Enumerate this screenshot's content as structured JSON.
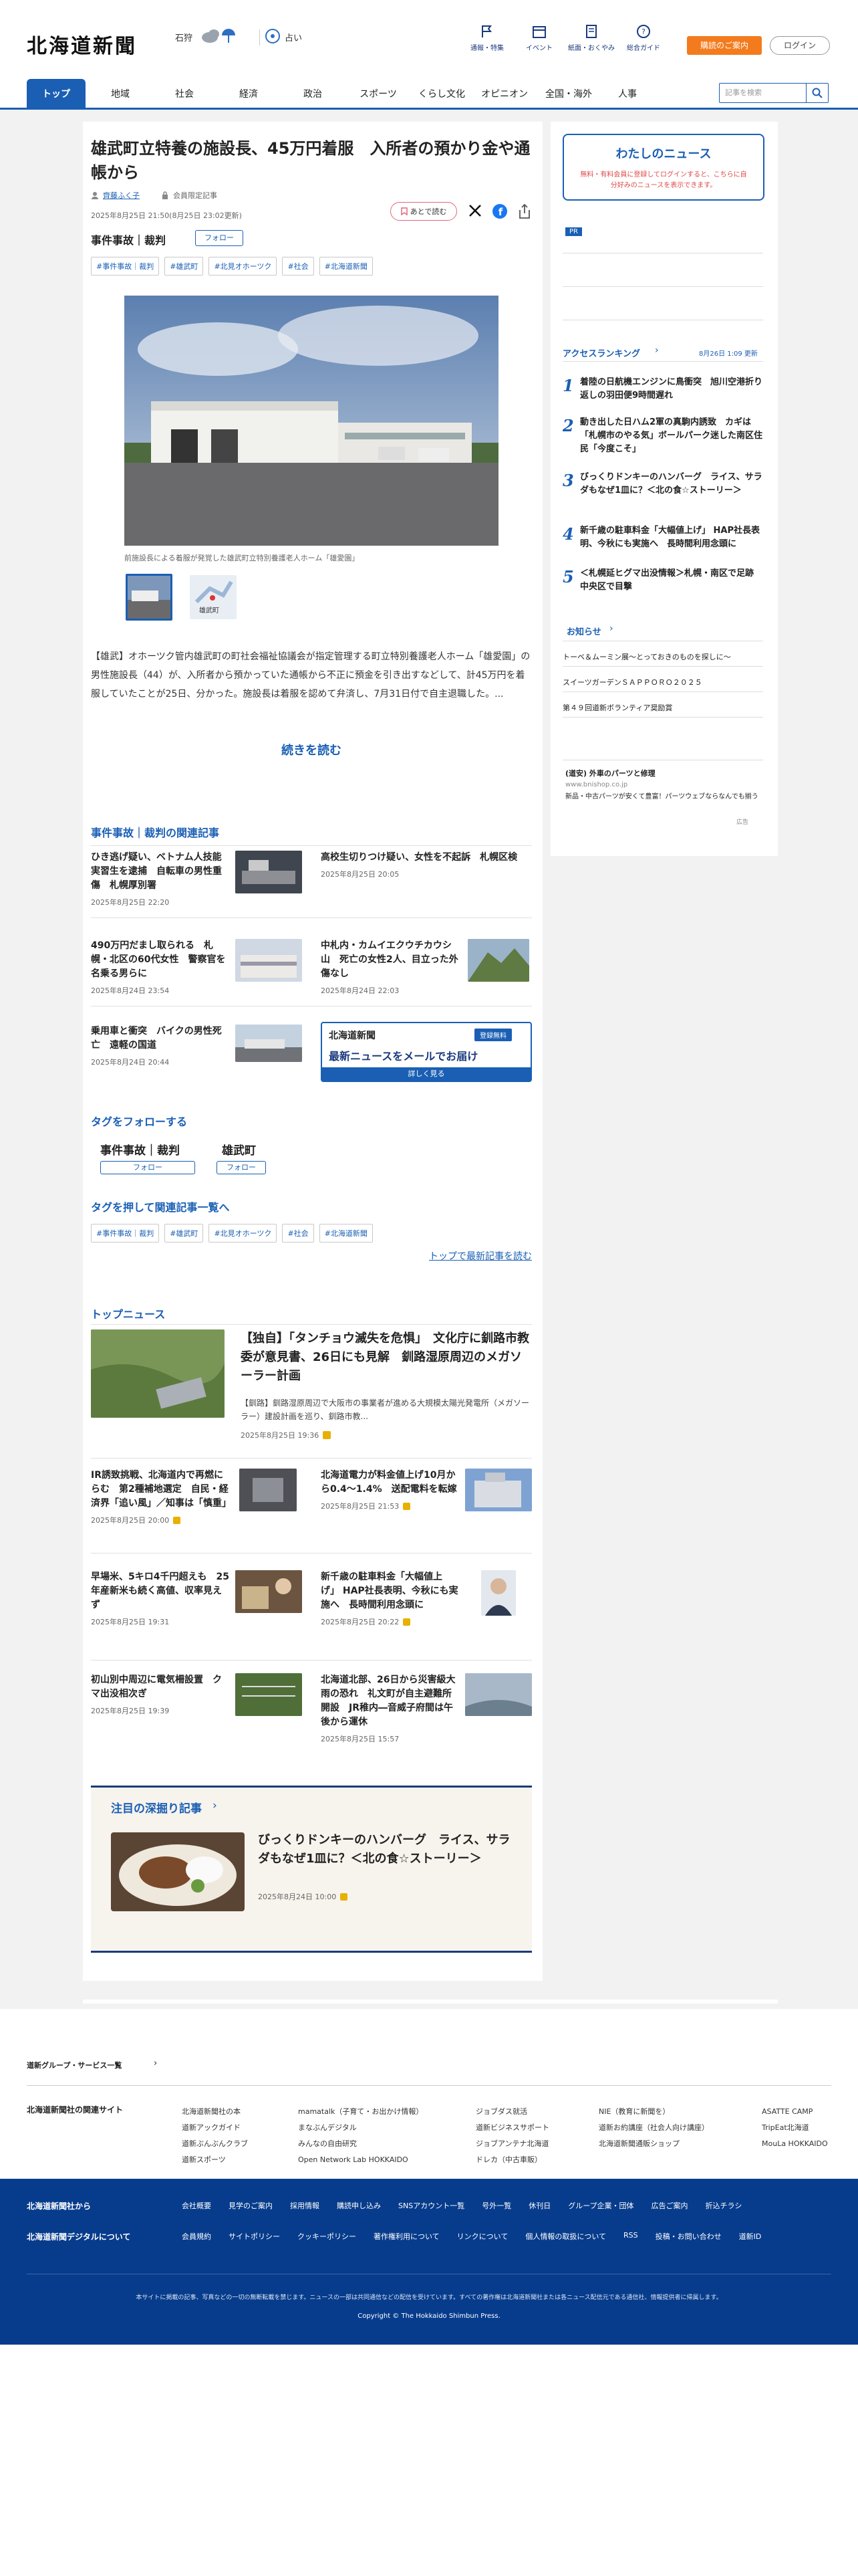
{
  "header": {
    "logo": "北海道新聞",
    "region": "石狩",
    "weather_label": "占い",
    "icons": [
      "通報・特集",
      "イベント",
      "紙面・おくやみ",
      "総合ガイド"
    ],
    "btn_promo": "購読のご案内",
    "btn_login": "ログイン"
  },
  "nav": {
    "items": [
      "トップ",
      "地域",
      "社会",
      "経済",
      "政治",
      "スポーツ",
      "くらし文化",
      "オピニオン",
      "全国・海外",
      "人事"
    ],
    "search_placeholder": "記事を検索"
  },
  "article": {
    "title": "雄武町立特養の施設長、45万円着服　入所者の預かり金や通帳から",
    "author": "齊藤ふく子",
    "member_label": "会員限定記事",
    "date": "2025年8月25日 21:50(8月25日 23:02更新)",
    "later_label": "あとで読む",
    "category": "事件事故｜裁判",
    "follow_label": "フォロー",
    "tags": [
      "#事件事故｜裁判",
      "#雄武町",
      "#北見オホーツク",
      "#社会",
      "#北海道新聞"
    ],
    "caption": "前施設長による着服が発覚した雄武町立特別養護老人ホーム「雄愛園」",
    "thumb2_label": "雄武町",
    "body": "【雄武】オホーツク管内雄武町の町社会福祉協議会が指定管理する町立特別養護老人ホーム「雄愛園」の男性施設長（44）が、入所者から預かっていた通帳から不正に預金を引き出すなどして、計45万円を着服していたことが25日、分かった。施設長は着服を認めて弁済し、7月31日付で自主退職した。...",
    "more": "続きを読む"
  },
  "related": {
    "heading": "事件事故｜裁判の関連記事",
    "items": [
      {
        "title": "ひき逃げ疑い、ベトナム人技能実習生を逮捕　自転車の男性重傷　札幌厚別署",
        "date": "2025年8月25日 22:20"
      },
      {
        "title": "高校生切りつけ疑い、女性を不起訴　札幌区検",
        "date": "2025年8月25日 20:05"
      },
      {
        "title": "490万円だまし取られる　札幌・北区の60代女性　警察官を名乗る男らに",
        "date": "2025年8月24日 23:54"
      },
      {
        "title": "中札内・カムイエクウチカウシ山　死亡の女性2人、目立った外傷なし",
        "date": "2025年8月24日 22:03"
      },
      {
        "title": "乗用車と衝突　バイクの男性死亡　遠軽の国道",
        "date": "2025年8月24日 20:44"
      }
    ],
    "ad": {
      "logo": "北海道新聞",
      "badge": "登録無料",
      "title": "最新ニュースをメールでお届け",
      "cta": "詳しく見る"
    }
  },
  "follow": {
    "heading": "タグをフォローする",
    "tags": [
      "事件事故｜裁判",
      "雄武町"
    ],
    "btn": "フォロー"
  },
  "tagrel": {
    "heading": "タグを押して関連記事一覧へ",
    "more": "トップで最新記事を読む"
  },
  "topnews": {
    "heading": "トップニュース",
    "lead": {
      "title": "【独自】「タンチョウ滅失を危惧」　文化庁に釧路市教委が意見書、26日にも見解　釧路湿原周辺のメガソーラー計画",
      "desc": "【釧路】釧路湿原周辺で大阪市の事業者が進める大規模太陽光発電所（メガソーラー）建設計画を巡り、釧路市教...",
      "date": "2025年8月25日 19:36"
    },
    "items": [
      {
        "title": "IR誘致挑戦、北海道内で再燃にらむ　第2種補地選定　自民・経済界「追い風」／知事は「慎重」",
        "date": "2025年8月25日 20:00"
      },
      {
        "title": "北海道電力が料金値上げ10月から0.4〜1.4%　送配電料を転嫁",
        "date": "2025年8月25日 21:53"
      },
      {
        "title": "早場米、5キロ4千円超えも　25年産新米も続く高値、収率見えず",
        "date": "2025年8月25日 19:31"
      },
      {
        "title": "新千歳の駐車料金「大幅値上げ」 HAP社長表明、今秋にも実施へ　長時間利用念頭に",
        "date": "2025年8月25日 20:22"
      },
      {
        "title": "初山別中周辺に電気柵設置　クマ出没相次ぎ",
        "date": "2025年8月25日 19:39"
      },
      {
        "title": "北海道北部、26日から災害級大雨の恐れ　礼文町が自主避難所開設　JR稚内―音威子府間は午後から運休",
        "date": "2025年8月25日 15:57"
      }
    ]
  },
  "feature": {
    "heading": "注目の深掘り記事",
    "title": "びっくりドンキーのハンバーグ　ライス、サラダもなぜ1皿に？＜北の食☆ストーリー＞",
    "date": "2025年8月24日 10:00"
  },
  "sidebar": {
    "mynews_title": "わたしのニュース",
    "mynews_desc": "無料・有料会員に登録してログインすると、こちらに自分好みのニュースを表示できます。",
    "mynews_link": "ログイン",
    "pr": "PR",
    "ranking_heading": "アクセスランキング",
    "ranking_date": "8月26日 1:09 更新",
    "ranking": [
      {
        "n": "1",
        "t": "着陸の日航機エンジンに鳥衝突　旭川空港折り返しの羽田便9時間遅れ"
      },
      {
        "n": "2",
        "t": "動き出した日ハム2軍の真駒内誘致　カギは「札幌市のやる気」ボールパーク迷した南区住民「今度こそ」"
      },
      {
        "n": "3",
        "t": "びっくりドンキーのハンバーグ　ライス、サラダもなぜ1皿に？＜北の食☆ストーリー＞"
      },
      {
        "n": "4",
        "t": "新千歳の駐車料金「大幅値上げ」 HAP社長表明、今秋にも実施へ　長時間利用念頭に"
      },
      {
        "n": "5",
        "t": "＜札幌延ヒグマ出没情報＞札幌・南区で足跡　中央区で目撃"
      }
    ],
    "notice_heading": "お知らせ",
    "notices": [
      "トーベ＆ムーミン展〜とっておきのものを探しに〜",
      "スイーツガーデンＳＡＰＰＯＲＯ２０２５",
      "第４９回道新ボランティア奨励賞"
    ],
    "ad_title": "(道安) 外車のパーツと修理",
    "ad_url": "www.bnishop.co.jp",
    "ad_desc": "新品・中古パーツが安くて豊富！パーツウェブならなんでも揃う",
    "ad_more": "広告"
  },
  "footer": {
    "group_label": "道新グループ・サービス一覧",
    "related_label": "北海道新聞社の関連サイト",
    "cols": [
      [
        "北海道新聞社の本",
        "道新アックガイド",
        "道新ぶんぶんクラブ",
        "道新スポーツ"
      ],
      [
        "mamatalk（子育て・お出かけ情報）",
        "まなぶんデジタル",
        "みんなの自由研究",
        "Open Network Lab HOKKAIDO"
      ],
      [
        "ジョブダス就活",
        "道新ビジネスサポート",
        "ジョブアンテナ北海道",
        "ドレカ（中古車販）"
      ],
      [
        "NIE（教育に新聞を）",
        "道新お約講座（社会人向け講座）",
        "北海道新聞通販ショップ"
      ],
      [
        "ASATTE CAMP",
        "TripEat北海道",
        "MouLa HOKKAIDO"
      ]
    ],
    "blue_row1_label": "北海道新聞社から",
    "blue_row1": [
      "会社概要",
      "見学のご案内",
      "採用情報",
      "購読申し込み",
      "SNSアカウント一覧",
      "号外一覧",
      "休刊日",
      "グループ企業・団体",
      "広告ご案内",
      "折込チラシ"
    ],
    "blue_row2_label": "北海道新聞デジタルについて",
    "blue_row2": [
      "会員規約",
      "サイトポリシー",
      "クッキーポリシー",
      "著作権利用について",
      "リンクについて",
      "個人情報の取扱について",
      "RSS",
      "投稿・お問い合わせ",
      "道新ID"
    ],
    "notice": "本サイトに掲載の記事、写真などの一切の無断転載を禁じます。ニュースの一部は共同通信などの配信を受けています。すべての著作権は北海道新聞社または各ニュース配信元である通信社、情報提供者に帰属します。",
    "copyright": "Copyright © The Hokkaido Shimbun Press."
  },
  "colors": {
    "brand": "#1a5fb4",
    "orange": "#f37b1d",
    "footer": "#073c8c"
  }
}
